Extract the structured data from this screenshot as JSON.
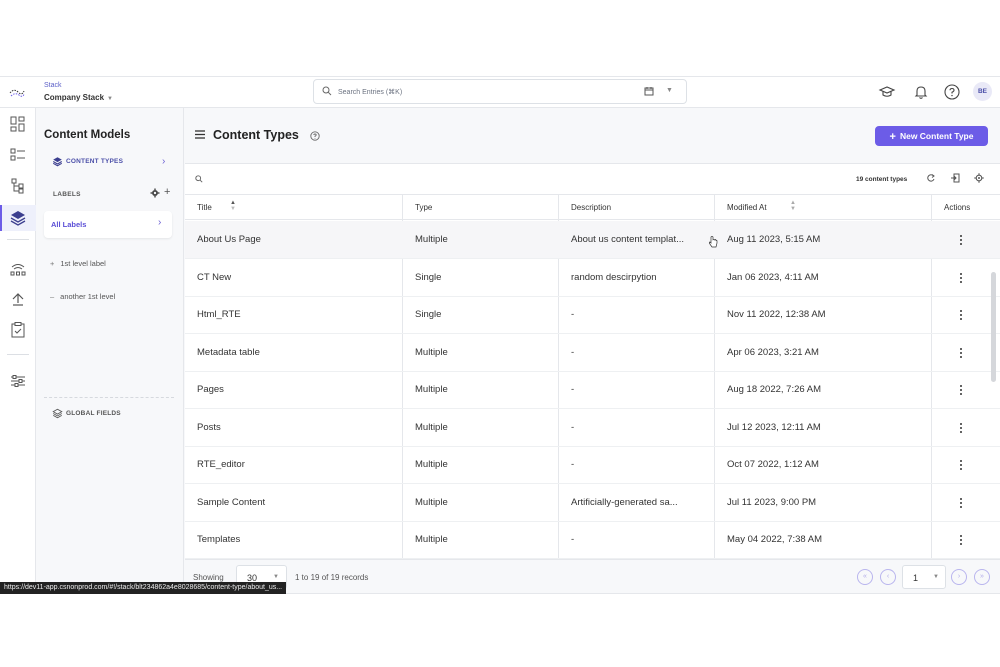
{
  "header": {
    "stack_label": "Stack",
    "stack_name": "Company Stack",
    "search_placeholder": "Search Entries (⌘K)",
    "avatar_initials": "BE",
    "icons": [
      "academy-icon",
      "bell-icon",
      "help-circle-icon"
    ]
  },
  "rail": {
    "icons": [
      "dashboard-icon",
      "entries-icon",
      "content-models-icon-tree",
      "layers-icon",
      "network-icon",
      "deploy-icon",
      "tasks-icon",
      "settings-sliders-icon"
    ],
    "active": "layers-icon"
  },
  "panel": {
    "title": "Content Models",
    "content_types_label": "CONTENT TYPES",
    "labels_heading": "LABELS",
    "all_labels": "All Labels",
    "levels": [
      {
        "sign": "+",
        "label": "1st level label"
      },
      {
        "sign": "–",
        "label": "another 1st level"
      }
    ],
    "global_fields_label": "GLOBAL FIELDS"
  },
  "main": {
    "title": "Content Types",
    "new_button": "New Content Type",
    "count_text": "19 content types",
    "columns": [
      "Title",
      "Type",
      "Description",
      "Modified At",
      "Actions"
    ],
    "rows": [
      {
        "title": "About Us Page",
        "type": "Multiple",
        "description": "About us content templat...",
        "modified": "Aug 11 2023, 5:15 AM"
      },
      {
        "title": "CT New",
        "type": "Single",
        "description": "random descirpytion",
        "modified": "Jan 06 2023, 4:11 AM"
      },
      {
        "title": "Html_RTE",
        "type": "Single",
        "description": "-",
        "modified": "Nov 11 2022, 12:38 AM"
      },
      {
        "title": "Metadata table",
        "type": "Multiple",
        "description": "-",
        "modified": "Apr 06 2023, 3:21 AM"
      },
      {
        "title": "Pages",
        "type": "Multiple",
        "description": "-",
        "modified": "Aug 18 2022, 7:26 AM"
      },
      {
        "title": "Posts",
        "type": "Multiple",
        "description": "-",
        "modified": "Jul 12 2023, 12:11 AM"
      },
      {
        "title": "RTE_editor",
        "type": "Multiple",
        "description": "-",
        "modified": "Oct 07 2022, 1:12 AM"
      },
      {
        "title": "Sample Content",
        "type": "Multiple",
        "description": "Artificially-generated sa...",
        "modified": "Jul 11 2023, 9:00 PM"
      },
      {
        "title": "Templates",
        "type": "Multiple",
        "description": "-",
        "modified": "May 04 2022, 7:38 AM"
      }
    ]
  },
  "footer": {
    "showing_label": "Showing",
    "page_size": "30",
    "range_text": "1 to 19 of 19 records",
    "page": "1"
  },
  "status_url": "https://dev11-app.csnonprod.com/#!/stack/blt234862a4e8028685/content-type/about_us...",
  "colors": {
    "accent": "#6c5ce7",
    "accent_text": "#5b4fd6"
  }
}
